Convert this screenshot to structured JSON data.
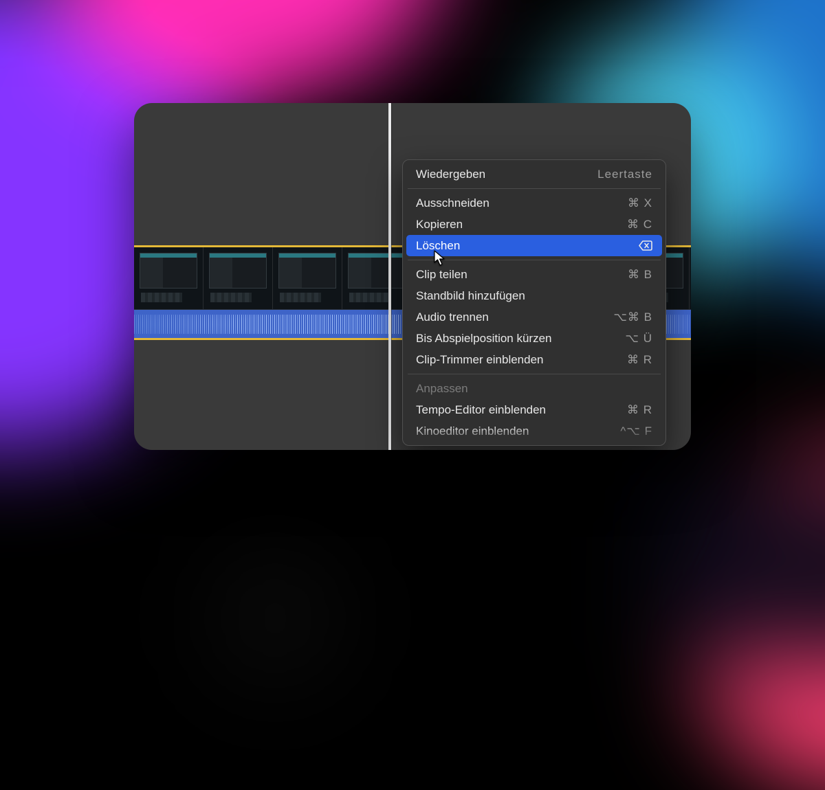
{
  "menu": {
    "groups": [
      [
        {
          "id": "play",
          "label": "Wiedergeben",
          "shortcut": "Leertaste",
          "shortcut_type": "text",
          "disabled": false,
          "highlight": false
        }
      ],
      [
        {
          "id": "cut",
          "label": "Ausschneiden",
          "shortcut": "⌘ X",
          "shortcut_type": "keys",
          "disabled": false,
          "highlight": false
        },
        {
          "id": "copy",
          "label": "Kopieren",
          "shortcut": "⌘ C",
          "shortcut_type": "keys",
          "disabled": false,
          "highlight": false
        },
        {
          "id": "delete",
          "label": "Löschen",
          "shortcut": "",
          "shortcut_type": "icon",
          "disabled": false,
          "highlight": true
        }
      ],
      [
        {
          "id": "split",
          "label": "Clip teilen",
          "shortcut": "⌘ B",
          "shortcut_type": "keys",
          "disabled": false,
          "highlight": false
        },
        {
          "id": "freeze",
          "label": "Standbild hinzufügen",
          "shortcut": "",
          "shortcut_type": "none",
          "disabled": false,
          "highlight": false
        },
        {
          "id": "detach",
          "label": "Audio trennen",
          "shortcut": "⌥⌘ B",
          "shortcut_type": "keys",
          "disabled": false,
          "highlight": false
        },
        {
          "id": "trim-to",
          "label": "Bis Abspielposition kürzen",
          "shortcut": "⌥ Ü",
          "shortcut_type": "keys",
          "disabled": false,
          "highlight": false
        },
        {
          "id": "trimmer",
          "label": "Clip-Trimmer einblenden",
          "shortcut": "⌘ R",
          "shortcut_type": "keys",
          "disabled": false,
          "highlight": false
        }
      ],
      [
        {
          "id": "adjust",
          "label": "Anpassen",
          "shortcut": "",
          "shortcut_type": "none",
          "disabled": true,
          "highlight": false
        },
        {
          "id": "tempo",
          "label": "Tempo-Editor einblenden",
          "shortcut": "⌘ R",
          "shortcut_type": "keys",
          "disabled": false,
          "highlight": false
        },
        {
          "id": "kino",
          "label": "Kinoeditor einblenden",
          "shortcut": "^⌥ F",
          "shortcut_type": "keys",
          "disabled": false,
          "highlight": false
        }
      ]
    ]
  },
  "colors": {
    "selection_border": "#e4b838",
    "audio_track": "#3e64c8",
    "highlight_blue": "#2a5fe0",
    "panel_bg": "#3a3a3a"
  }
}
